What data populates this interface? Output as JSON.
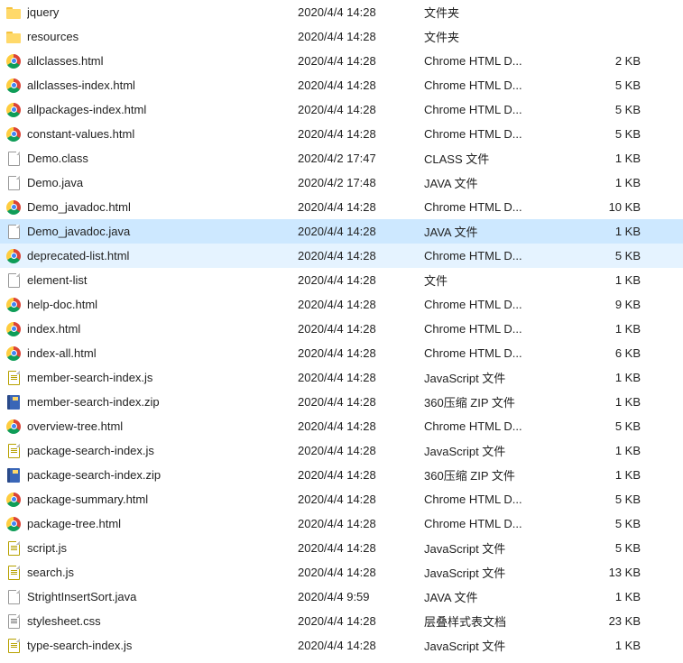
{
  "files": [
    {
      "icon": "folder",
      "name": "jquery",
      "date": "2020/4/4 14:28",
      "type": "文件夹",
      "size": ""
    },
    {
      "icon": "folder",
      "name": "resources",
      "date": "2020/4/4 14:28",
      "type": "文件夹",
      "size": ""
    },
    {
      "icon": "chrome",
      "name": "allclasses.html",
      "date": "2020/4/4 14:28",
      "type": "Chrome HTML D...",
      "size": "2 KB"
    },
    {
      "icon": "chrome",
      "name": "allclasses-index.html",
      "date": "2020/4/4 14:28",
      "type": "Chrome HTML D...",
      "size": "5 KB"
    },
    {
      "icon": "chrome",
      "name": "allpackages-index.html",
      "date": "2020/4/4 14:28",
      "type": "Chrome HTML D...",
      "size": "5 KB"
    },
    {
      "icon": "chrome",
      "name": "constant-values.html",
      "date": "2020/4/4 14:28",
      "type": "Chrome HTML D...",
      "size": "5 KB"
    },
    {
      "icon": "file",
      "name": "Demo.class",
      "date": "2020/4/2 17:47",
      "type": "CLASS 文件",
      "size": "1 KB"
    },
    {
      "icon": "file",
      "name": "Demo.java",
      "date": "2020/4/2 17:48",
      "type": "JAVA 文件",
      "size": "1 KB"
    },
    {
      "icon": "chrome",
      "name": "Demo_javadoc.html",
      "date": "2020/4/4 14:28",
      "type": "Chrome HTML D...",
      "size": "10 KB"
    },
    {
      "icon": "file",
      "name": "Demo_javadoc.java",
      "date": "2020/4/4 14:28",
      "type": "JAVA 文件",
      "size": "1 KB",
      "state": "selected"
    },
    {
      "icon": "chrome",
      "name": "deprecated-list.html",
      "date": "2020/4/4 14:28",
      "type": "Chrome HTML D...",
      "size": "5 KB",
      "state": "hover"
    },
    {
      "icon": "file",
      "name": "element-list",
      "date": "2020/4/4 14:28",
      "type": "文件",
      "size": "1 KB"
    },
    {
      "icon": "chrome",
      "name": "help-doc.html",
      "date": "2020/4/4 14:28",
      "type": "Chrome HTML D...",
      "size": "9 KB"
    },
    {
      "icon": "chrome",
      "name": "index.html",
      "date": "2020/4/4 14:28",
      "type": "Chrome HTML D...",
      "size": "1 KB"
    },
    {
      "icon": "chrome",
      "name": "index-all.html",
      "date": "2020/4/4 14:28",
      "type": "Chrome HTML D...",
      "size": "6 KB"
    },
    {
      "icon": "js",
      "name": "member-search-index.js",
      "date": "2020/4/4 14:28",
      "type": "JavaScript 文件",
      "size": "1 KB"
    },
    {
      "icon": "zip",
      "name": "member-search-index.zip",
      "date": "2020/4/4 14:28",
      "type": "360压缩 ZIP 文件",
      "size": "1 KB"
    },
    {
      "icon": "chrome",
      "name": "overview-tree.html",
      "date": "2020/4/4 14:28",
      "type": "Chrome HTML D...",
      "size": "5 KB"
    },
    {
      "icon": "js",
      "name": "package-search-index.js",
      "date": "2020/4/4 14:28",
      "type": "JavaScript 文件",
      "size": "1 KB"
    },
    {
      "icon": "zip",
      "name": "package-search-index.zip",
      "date": "2020/4/4 14:28",
      "type": "360压缩 ZIP 文件",
      "size": "1 KB"
    },
    {
      "icon": "chrome",
      "name": "package-summary.html",
      "date": "2020/4/4 14:28",
      "type": "Chrome HTML D...",
      "size": "5 KB"
    },
    {
      "icon": "chrome",
      "name": "package-tree.html",
      "date": "2020/4/4 14:28",
      "type": "Chrome HTML D...",
      "size": "5 KB"
    },
    {
      "icon": "js",
      "name": "script.js",
      "date": "2020/4/4 14:28",
      "type": "JavaScript 文件",
      "size": "5 KB"
    },
    {
      "icon": "js",
      "name": "search.js",
      "date": "2020/4/4 14:28",
      "type": "JavaScript 文件",
      "size": "13 KB"
    },
    {
      "icon": "file",
      "name": "StrightInsertSort.java",
      "date": "2020/4/4 9:59",
      "type": "JAVA 文件",
      "size": "1 KB"
    },
    {
      "icon": "css",
      "name": "stylesheet.css",
      "date": "2020/4/4 14:28",
      "type": "层叠样式表文档",
      "size": "23 KB"
    },
    {
      "icon": "js",
      "name": "type-search-index.js",
      "date": "2020/4/4 14:28",
      "type": "JavaScript 文件",
      "size": "1 KB"
    }
  ],
  "watermark": ""
}
